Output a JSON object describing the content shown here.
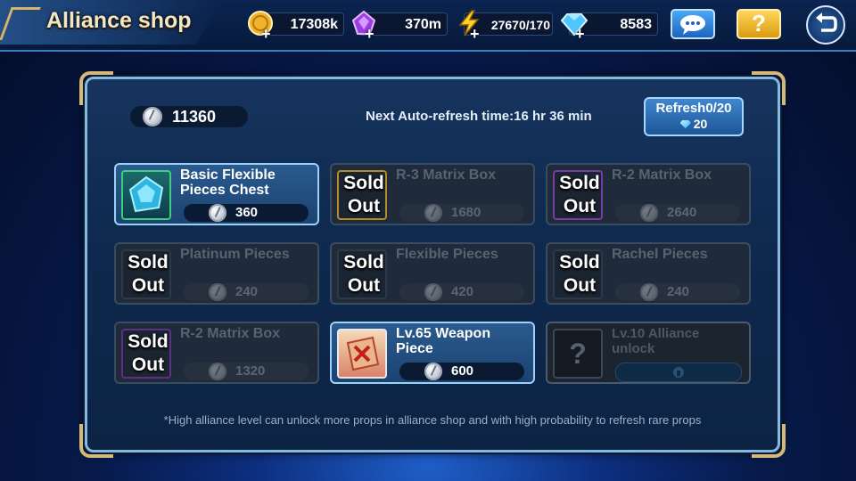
{
  "header": {
    "title": "Alliance shop",
    "resources": [
      {
        "name": "gold",
        "value": "17308k",
        "icon": "gold-coin-icon"
      },
      {
        "name": "purple-crystal",
        "value": "370m",
        "icon": "purple-crystal-icon"
      },
      {
        "name": "energy",
        "value": "27670/170",
        "icon": "lightning-icon"
      },
      {
        "name": "diamond",
        "value": "8583",
        "icon": "diamond-icon"
      }
    ],
    "help_label": "?"
  },
  "panel": {
    "alliance_coins": "11360",
    "next_refresh": "Next Auto-refresh time:16 hr 36 min",
    "refresh_button": {
      "label": "Refresh0/20",
      "cost": "20"
    },
    "footnote": "*High alliance level can unlock more props in alliance shop and with high probability to refresh rare props"
  },
  "items": [
    {
      "name": "Basic Flexible Pieces Chest",
      "price": "360",
      "sold_top": "",
      "sold_bottom": "",
      "state": "available"
    },
    {
      "name": "R-3 Matrix Box",
      "price": "1680",
      "sold_top": "Sold",
      "sold_bottom": "Out",
      "state": "sold"
    },
    {
      "name": "R-2 Matrix Box",
      "price": "2640",
      "sold_top": "Sold",
      "sold_bottom": "Out",
      "state": "sold"
    },
    {
      "name": "Platinum Pieces",
      "price": "240",
      "sold_top": "Sold",
      "sold_bottom": "Out",
      "state": "sold"
    },
    {
      "name": "Flexible Pieces",
      "price": "420",
      "sold_top": "Sold",
      "sold_bottom": "Out",
      "state": "sold"
    },
    {
      "name": "Rachel Pieces",
      "price": "240",
      "sold_top": "Sold",
      "sold_bottom": "Out",
      "state": "sold"
    },
    {
      "name": "R-2 Matrix Box",
      "price": "1320",
      "sold_top": "Sold",
      "sold_bottom": "Out",
      "state": "sold"
    },
    {
      "name": "Lv.65 Weapon Piece",
      "price": "600",
      "sold_top": "",
      "sold_bottom": "",
      "state": "available"
    },
    {
      "name": "Lv.10 Alliance unlock",
      "price": "",
      "sold_top": "",
      "sold_bottom": "",
      "state": "locked",
      "icon_text": "?"
    }
  ],
  "colors": {
    "accent": "#86b9e0",
    "gold_trim": "#d6b878",
    "active_card": "#2a5a8e"
  }
}
